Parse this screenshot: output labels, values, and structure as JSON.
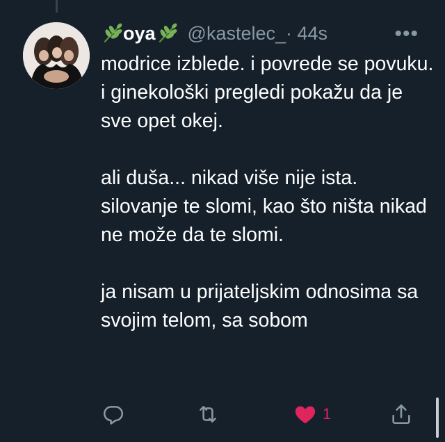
{
  "tweet": {
    "display_name": "oya",
    "handle": "@kastelec_",
    "time": "· 44s",
    "more_label": "•••",
    "paragraphs": [
      "modrice izblede. i povrede se povuku.",
      "i ginekološki pregledi pokažu da je sve opet okej.",
      "",
      "ali duša... nikad više nije ista.",
      "silovanje te slomi, kao što ništa nikad ne može da te slomi.",
      "",
      "ja nisam u prijateljskim odnosima sa svojim telom, sa sobom"
    ],
    "like_count": "1"
  },
  "icons": {
    "name_prefix": "herb-icon",
    "name_suffix": "herb-icon",
    "reply": "reply-icon",
    "retweet": "retweet-icon",
    "like": "heart-icon",
    "share": "share-icon"
  },
  "colors": {
    "background": "#15202b",
    "text": "#ffffff",
    "muted": "#8899a6",
    "like": "#e0245e",
    "leaf": "#77b255"
  }
}
